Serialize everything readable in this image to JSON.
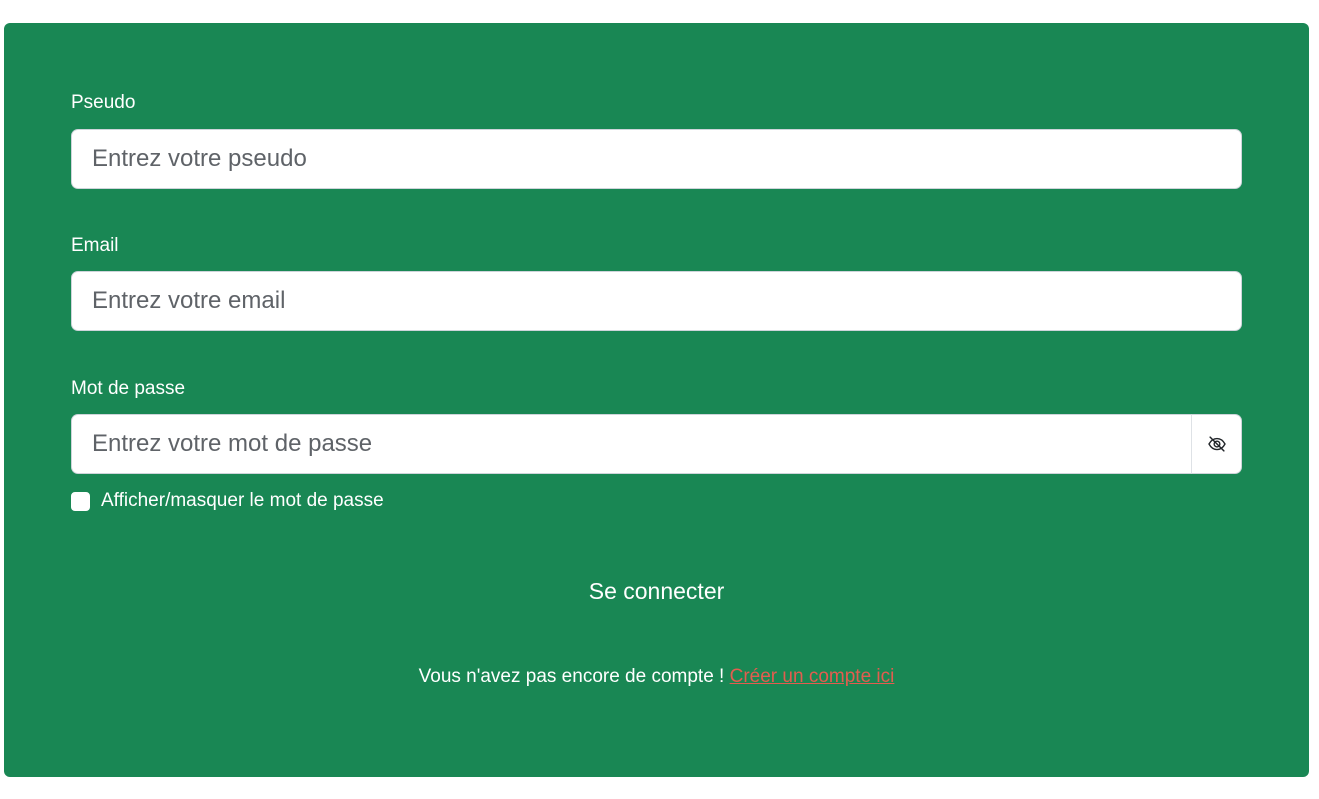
{
  "form": {
    "pseudo": {
      "label": "Pseudo",
      "placeholder": "Entrez votre pseudo"
    },
    "email": {
      "label": "Email",
      "placeholder": "Entrez votre email"
    },
    "password": {
      "label": "Mot de passe",
      "placeholder": "Entrez votre mot de passe",
      "toggle_icon": "eye-slash-icon"
    },
    "show_password": {
      "label": "Afficher/masquer le mot de passe",
      "checked": false
    },
    "submit_label": "Se connecter"
  },
  "signup": {
    "text": "Vous n'avez pas encore de compte !",
    "link_label": "Créer un compte ici"
  },
  "colors": {
    "card_background": "#198754",
    "link": "#e35d4f",
    "text": "#ffffff"
  }
}
